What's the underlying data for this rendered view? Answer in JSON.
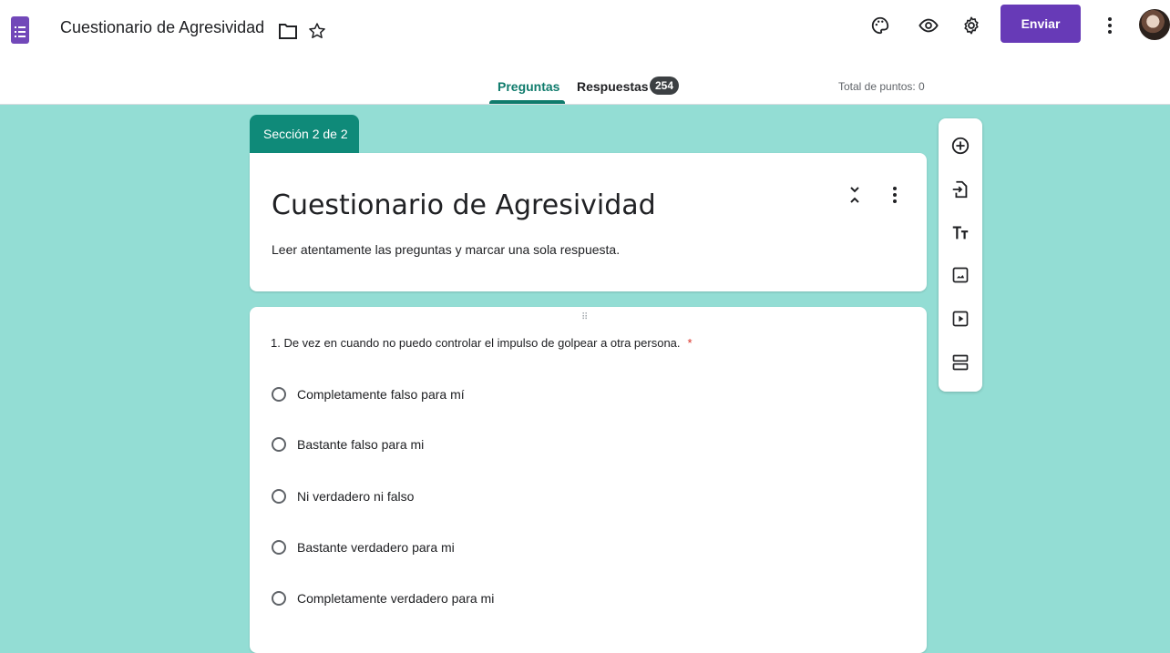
{
  "app": {
    "title": "Cuestionario de Agresividad"
  },
  "header": {
    "send_label": "Enviar"
  },
  "tabs": {
    "questions_label": "Preguntas",
    "responses_label": "Respuestas",
    "responses_count": "254",
    "total_points": "Total de puntos: 0"
  },
  "section": {
    "label": "Sección 2 de 2",
    "title": "Cuestionario de Agresividad",
    "description": "Leer atentamente las preguntas y marcar una sola respuesta."
  },
  "question": {
    "text": "1. De vez en cuando no puedo controlar el impulso de golpear a otra persona.",
    "required_mark": "*",
    "options": [
      "Completamente falso para mí",
      "Bastante falso para mi",
      "Ni verdadero ni falso",
      "Bastante verdadero para mi",
      "Completamente verdadero para mi"
    ]
  },
  "icons": {
    "header": [
      "folder-icon",
      "star-icon",
      "palette-icon",
      "eye-icon",
      "settings-icon",
      "more-vert-icon"
    ],
    "toolbar": [
      "add-question-icon",
      "import-questions-icon",
      "title-text-icon",
      "image-icon",
      "video-icon",
      "section-icon"
    ]
  },
  "colors": {
    "background": "#93ddd4",
    "accent": "#0f7b6c",
    "brand": "#673ab7"
  }
}
